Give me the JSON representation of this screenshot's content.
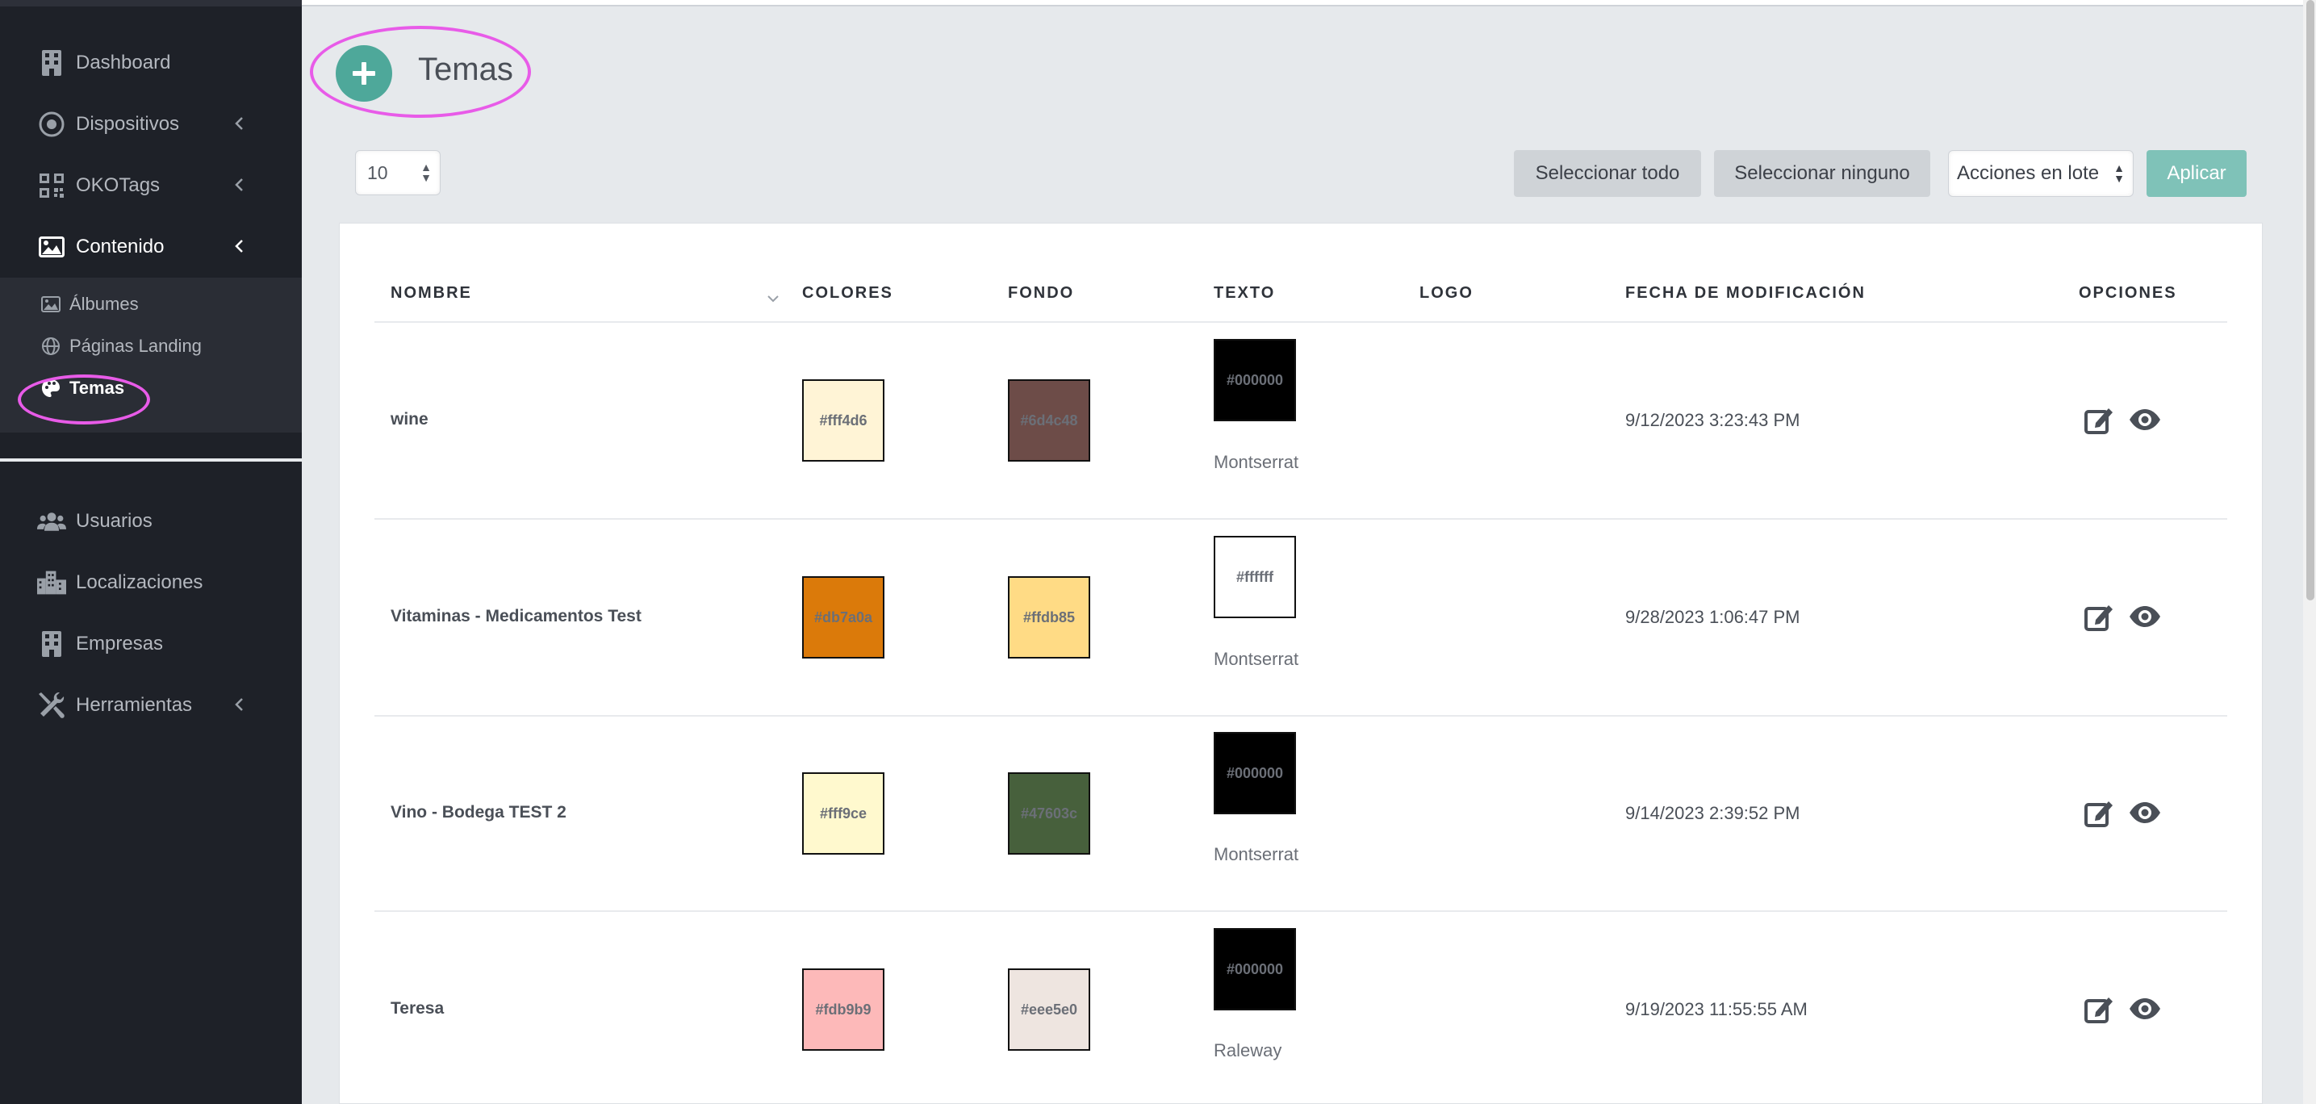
{
  "sidebar": {
    "items": [
      {
        "label": "Dashboard",
        "icon": "building-icon"
      },
      {
        "label": "Dispositivos",
        "icon": "target-icon"
      },
      {
        "label": "OKOTags",
        "icon": "qrcode-icon"
      },
      {
        "label": "Contenido",
        "icon": "image-icon"
      },
      {
        "label": "Usuarios",
        "icon": "users-icon"
      },
      {
        "label": "Localizaciones",
        "icon": "city-icon"
      },
      {
        "label": "Empresas",
        "icon": "building-icon"
      },
      {
        "label": "Herramientas",
        "icon": "tools-icon"
      }
    ],
    "submenu": [
      {
        "label": "Álbumes",
        "icon": "image-icon"
      },
      {
        "label": "Páginas Landing",
        "icon": "globe-icon"
      },
      {
        "label": "Temas",
        "icon": "palette-icon"
      }
    ]
  },
  "header": {
    "title": "Temas"
  },
  "toolbar": {
    "per_page": "10",
    "select_all": "Seleccionar todo",
    "select_none": "Seleccionar ninguno",
    "bulk_actions": "Acciones en lote",
    "apply": "Aplicar"
  },
  "table": {
    "columns": [
      "NOMBRE",
      "COLORES",
      "FONDO",
      "TEXTO",
      "LOGO",
      "FECHA DE MODIFICACIÓN",
      "OPCIONES"
    ],
    "rows": [
      {
        "name": "wine",
        "color": "#fff4d6",
        "bg": "#6d4c48",
        "text_color": "#000000",
        "font": "Montserrat",
        "date": "9/12/2023 3:23:43 PM"
      },
      {
        "name": "Vitaminas - Medicamentos Test",
        "color": "#db7a0a",
        "bg": "#ffdb85",
        "text_color": "#ffffff",
        "font": "Montserrat",
        "date": "9/28/2023 1:06:47 PM"
      },
      {
        "name": "Vino - Bodega TEST 2",
        "color": "#fff9ce",
        "bg": "#47603c",
        "text_color": "#000000",
        "font": "Montserrat",
        "date": "9/14/2023 2:39:52 PM"
      },
      {
        "name": "Teresa",
        "color": "#fdb9b9",
        "bg": "#eee5e0",
        "text_color": "#000000",
        "font": "Raleway",
        "date": "9/19/2023 11:55:55 AM"
      }
    ],
    "swatch_labels": {
      "row0": {
        "color": "#fff4d6",
        "bg": "#6d4c48",
        "text": "#000000"
      },
      "row1": {
        "color": "#db7a0a",
        "bg": "#ffdb85",
        "text": "#ffffff"
      },
      "row2": {
        "color": "#fff9ce",
        "bg": "#47603c",
        "text": "#000000"
      },
      "row3": {
        "color": "#fdb9b9",
        "bg": "#eee5e0",
        "text": "#000000"
      }
    }
  },
  "colors": {
    "accent": "#4ea89a",
    "apply": "#7fc2b8",
    "annotation": "#e85be8",
    "sidebar_bg": "#1e2128"
  }
}
